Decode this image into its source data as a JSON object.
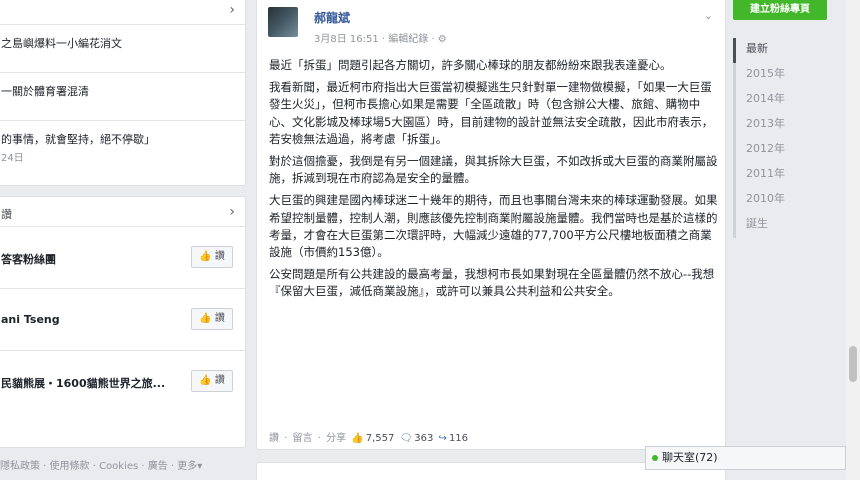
{
  "left": {
    "news_items": [
      {
        "text": "之島嶼爆料一小編花消文",
        "sub": ""
      },
      {
        "text": "一關於體育署混清",
        "sub": ""
      },
      {
        "text": "的事情，就會堅持，絕不停歇」",
        "sub": "24日"
      }
    ],
    "pages_card_title": "讚",
    "pages": [
      {
        "name": "答客粉絲團",
        "like": "讚"
      },
      {
        "name": "ani Tseng",
        "like": "讚"
      },
      {
        "name": "民貓熊展・1600貓熊世界之旅...",
        "like": "讚"
      }
    ],
    "footer": "隱私政策 · 使用條款 · Cookies · 廣告 · 更多▾"
  },
  "post": {
    "author": "郝龍斌",
    "meta": "3月8日 16:51 · 編輯紀錄 · ⚙",
    "paragraphs": [
      "最近「拆蛋」問題引起各方關切，許多關心棒球的朋友都紛紛來跟我表達憂心。",
      "我看新聞，最近柯市府指出大巨蛋當初模擬逃生只針對單一建物做模擬，「如果一大巨蛋發生火災」，但柯市長擔心如果是需要「全區疏散」時（包含辦公大樓、旅館、購物中心、文化影城及棒球場5大園區）時，目前建物的設計並無法安全疏散，因此市府表示，若安檢無法過過，將考慮「拆蛋」。",
      "對於這個擔憂，我倒是有另一個建議，與其拆除大巨蛋，不如改拆或大巨蛋的商業附屬設施，拆減到現在市府認為是安全的量體。",
      "大巨蛋的興建是國內棒球迷二十幾年的期待，而且也事關台灣未來的棒球運動發展。如果希望控制量體，控制人潮，則應該優先控制商業附屬設施量體。我們當時也是基於這樣的考量，才會在大巨蛋第二次環評時，大幅減少遠雄的77,700平方公尺樓地板面積之商業設施（市價約153億）。",
      "公安問題是所有公共建設的最高考量，我想柯市長如果對現在全區量體仍然不放心--我想『保留大巨蛋，減低商業設施』，或許可以兼具公共利益和公共安全。"
    ],
    "actions": {
      "like": "讚",
      "comment": "留言",
      "share": "分享",
      "likes_count": "7,557",
      "comments_count": "363",
      "shares_count": "116"
    }
  },
  "right": {
    "create_page_button": "建立粉絲專頁",
    "timeline": [
      "最新",
      "2015年",
      "2014年",
      "2013年",
      "2012年",
      "2011年",
      "2010年",
      "誕生"
    ]
  },
  "chat": {
    "label": "聊天室(72)"
  },
  "colors": {
    "link": "#365899",
    "green": "#42b72a",
    "bg": "#e9ebee"
  }
}
